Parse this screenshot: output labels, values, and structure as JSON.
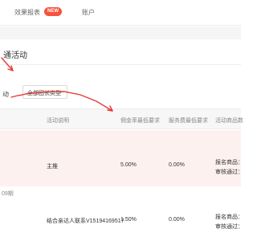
{
  "tabs": {
    "items": [
      {
        "label": "效果报表"
      },
      {
        "label": "账户"
      }
    ],
    "badge": "NEW"
  },
  "page": {
    "title": "通活动"
  },
  "filters": {
    "left_text": "动",
    "select_value": "全部团长类型"
  },
  "table": {
    "columns": [
      "活动说明",
      "佣金率最低要求",
      "服务费最低要求",
      "活动商品数"
    ],
    "rows": [
      {
        "desc": "主推",
        "commission": "5.00%",
        "service_fee": "0.00%",
        "goods_line1": "报名商品：",
        "goods_line2": "审核通过："
      },
      {
        "left_label": "09期",
        "desc": "结合亲达人联系V15194169517",
        "commission": "1.50%",
        "service_fee": "0.00%",
        "goods_line1": "报名商品：",
        "goods_line2": "审核通过："
      }
    ]
  },
  "colors": {
    "accent": "#f5523e",
    "arrow": "#e53935",
    "row_highlight": "#fdf1ef"
  }
}
